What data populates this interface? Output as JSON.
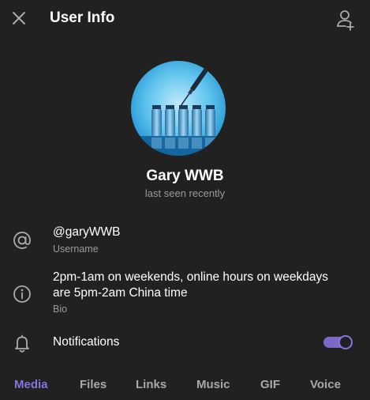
{
  "header": {
    "title": "User Info"
  },
  "profile": {
    "name": "Gary WWB",
    "status": "last seen recently"
  },
  "info": {
    "username": {
      "value": "@garyWWB",
      "label": "Username"
    },
    "bio": {
      "line1": "2pm-1am on weekends, online hours on weekdays",
      "line2": "are 5pm-2am China time",
      "label": "Bio"
    },
    "notifications": {
      "label": "Notifications",
      "enabled": true
    }
  },
  "tabs": [
    {
      "label": "Media",
      "active": true
    },
    {
      "label": "Files",
      "active": false
    },
    {
      "label": "Links",
      "active": false
    },
    {
      "label": "Music",
      "active": false
    },
    {
      "label": "GIF",
      "active": false
    },
    {
      "label": "Voice",
      "active": false
    }
  ],
  "colors": {
    "background": "#212121",
    "accent": "#8774e1",
    "secondary_text": "#9a9a9a"
  }
}
